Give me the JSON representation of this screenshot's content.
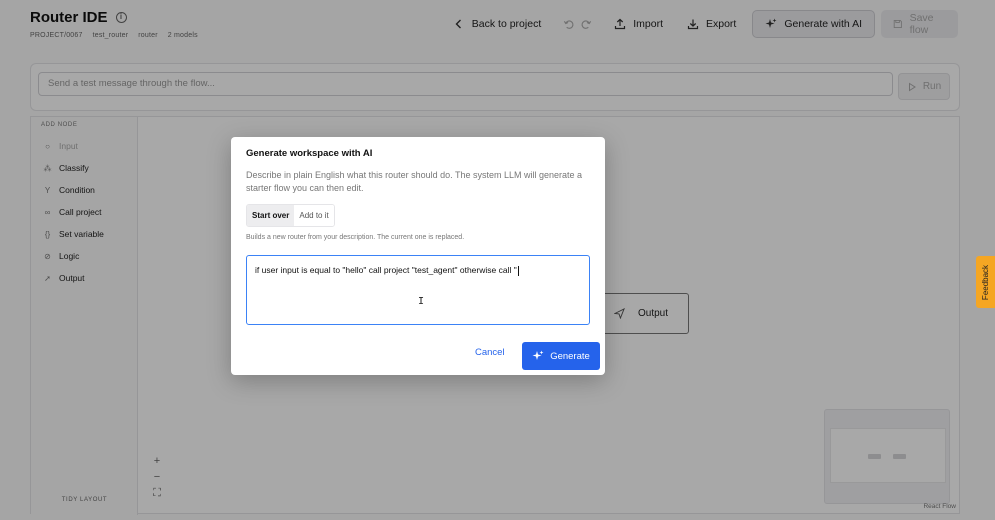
{
  "header": {
    "title": "Router IDE",
    "meta": [
      "PROJECT/0067",
      "test_router",
      "router",
      "2 models"
    ]
  },
  "toolbar": {
    "back_label": "Back to project",
    "import_label": "Import",
    "export_label": "Export",
    "generate_label": "Generate with AI",
    "save_label": "Save flow"
  },
  "test_bar": {
    "placeholder": "Send a test message through the flow...",
    "run_label": "Run"
  },
  "node_panel": {
    "heading": "ADD NODE",
    "items": [
      {
        "label": "Input",
        "icon": "circle-icon"
      },
      {
        "label": "Classify",
        "icon": "classify-icon"
      },
      {
        "label": "Condition",
        "icon": "branch-icon"
      },
      {
        "label": "Call project",
        "icon": "link-icon"
      },
      {
        "label": "Set variable",
        "icon": "braces-icon"
      },
      {
        "label": "Logic",
        "icon": "logic-icon"
      },
      {
        "label": "Output",
        "icon": "send-icon"
      }
    ],
    "tidy_label": "TIDY LAYOUT"
  },
  "canvas": {
    "output_node_label": "Output",
    "attribution": "React Flow"
  },
  "feedback_label": "Feedback",
  "modal": {
    "title": "Generate workspace with AI",
    "description": "Describe in plain English what this router should do. The system LLM will generate a starter flow you can then edit.",
    "mode_options": [
      "Start over",
      "Add to it"
    ],
    "mode_hint": "Builds a new router from your description. The current one is replaced.",
    "prompt_value": "if user input is equal to \"hello\" call project \"test_agent\" otherwise call \"",
    "cancel_label": "Cancel",
    "generate_label": "Generate"
  },
  "colors": {
    "primary": "#2563eb",
    "feedback": "#f5a623",
    "focus_ring": "#3b82f6"
  }
}
